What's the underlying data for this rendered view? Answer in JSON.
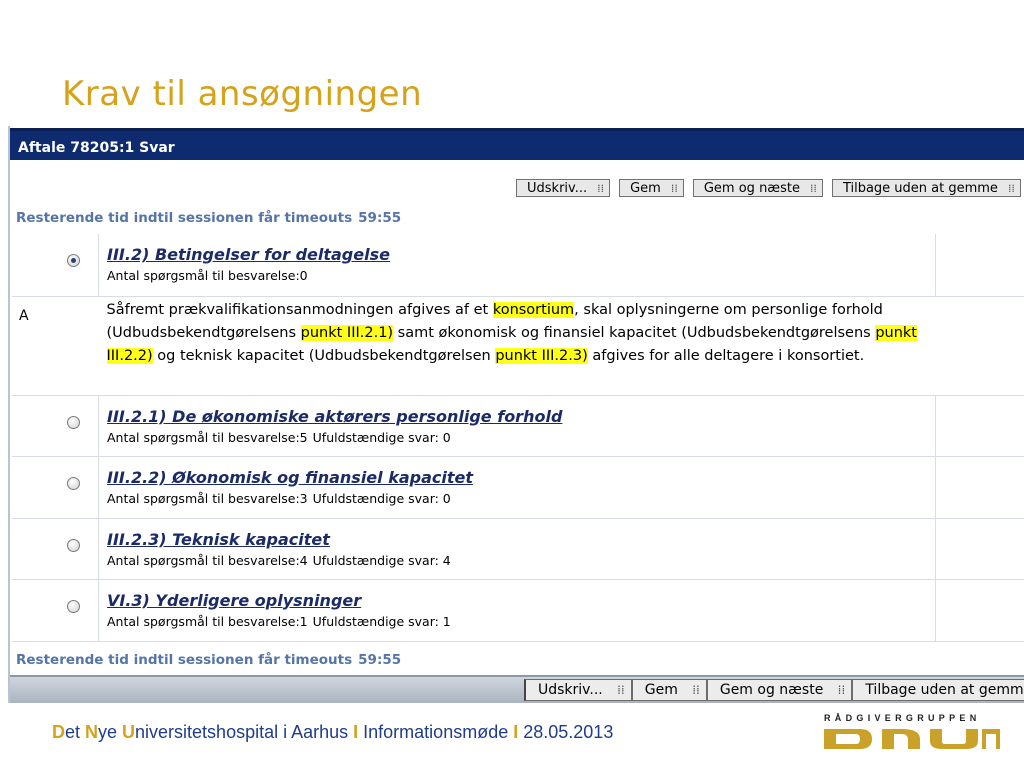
{
  "slide": {
    "title": "Krav til ansøgningen",
    "footer": {
      "p1": "D",
      "p2": "et ",
      "p3": "N",
      "p4": "ye ",
      "p5": "U",
      "p6": "niversitetshospital i Aarhus ",
      "sep1": "I",
      "p7": " Informationsmøde ",
      "sep2": "I",
      "p8": " 28.05.2013"
    },
    "logo": {
      "top": "RÅDGIVERGRUPPEN",
      "main": "DNU"
    }
  },
  "window": {
    "title": "Aftale 78205:1 Svar",
    "toolbar": [
      "Udskriv...",
      "Gem",
      "Gem og næste",
      "Tilbage uden at gemme"
    ],
    "timeout_label": "Resterende tid indtil sessionen får timeouts",
    "timeout_value": "59:55",
    "questions": [
      {
        "title": "III.2) Betingelser for deltagelse",
        "count": "Antal spørgsmål til besvarelse:0",
        "selected": true
      },
      {
        "title": "III.2.1) De økonomiske aktørers personlige forhold",
        "count": "Antal spørgsmål til besvarelse:5",
        "incomplete": "Ufuldstændige svar: 0",
        "selected": false
      },
      {
        "title": "III.2.2) Økonomisk og finansiel kapacitet",
        "count": "Antal spørgsmål til besvarelse:3",
        "incomplete": "Ufuldstændige svar: 0",
        "selected": false
      },
      {
        "title": "III.2.3) Teknisk kapacitet",
        "count": "Antal spørgsmål til besvarelse:4",
        "incomplete": "Ufuldstændige svar: 4",
        "selected": false
      },
      {
        "title": "VI.3) Yderligere oplysninger",
        "count": "Antal spørgsmål til besvarelse:1",
        "incomplete": "Ufuldstændige svar: 1",
        "selected": false
      }
    ],
    "rowA": {
      "label": "A",
      "t1": "Såfremt prækvalifikationsanmodningen afgives af et ",
      "h1": "konsortium",
      "t2": ", skal oplysningerne om personlige forhold (Udbudsbekendtgørelsens ",
      "h2": "punkt III.2.1)",
      "t3": " samt økonomisk og finansiel kapacitet (Udbudsbekendtgørelsens ",
      "h3": "punkt III.2.2)",
      "t4": " og teknisk kapacitet (Udbudsbekendtgørelsen ",
      "h4": "punkt III.2.3)",
      "t5": " afgives for alle deltagere i konsortiet."
    },
    "highlight_color": "#ffff1a"
  }
}
